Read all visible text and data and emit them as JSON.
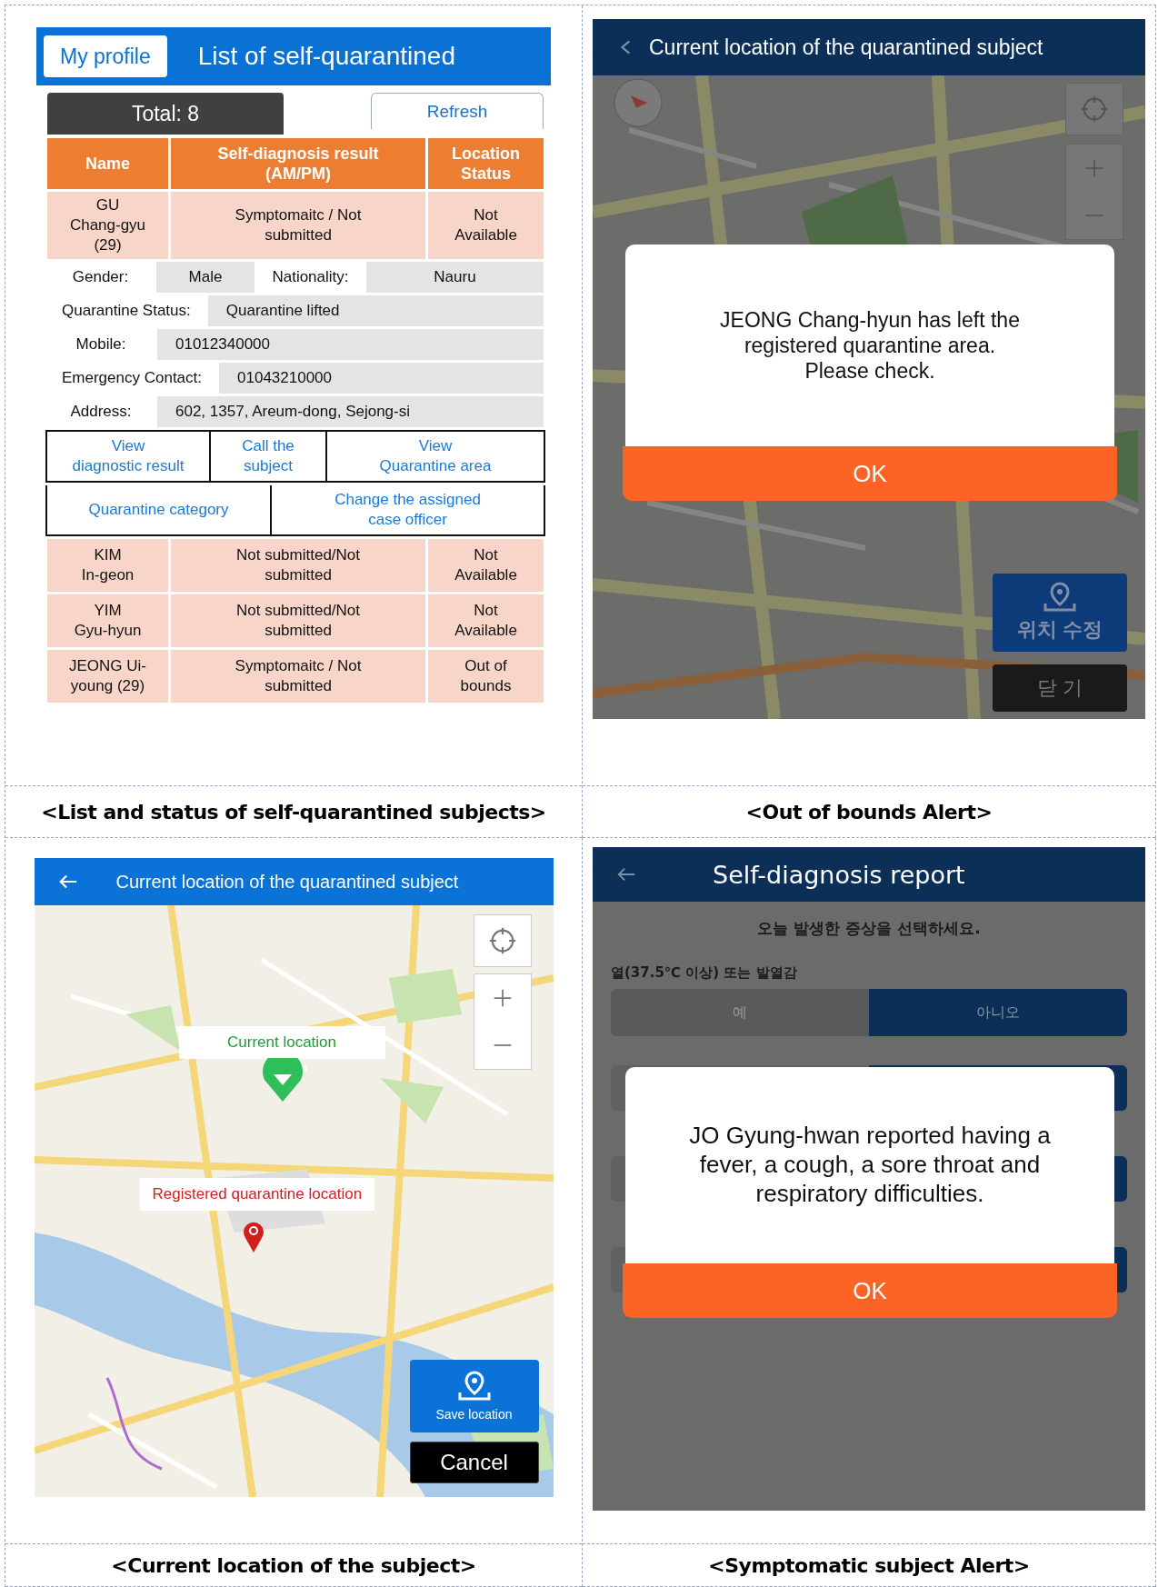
{
  "panels": [
    {
      "kind": "list",
      "caption": "<List and status of self-quarantined subjects>",
      "tab": "My profile",
      "title": "List of self-quarantined",
      "total": "Total: 8",
      "refresh": "Refresh",
      "columns": [
        "Name",
        "Self-diagnosis result\n(AM/PM)",
        "Location\nStatus"
      ],
      "rows": [
        {
          "name": "GU\nChang-gyu\n(29)",
          "result": "Symptomaitc / Not\nsubmitted",
          "location": "Not\nAvailable",
          "details": [
            [
              {
                "label": "Gender:",
                "value": "Male"
              },
              {
                "label": "Nationality:",
                "value": "Nauru"
              }
            ],
            [
              {
                "label": "Quarantine Status:",
                "value": "Quarantine lifted"
              }
            ],
            [
              {
                "label": "Mobile:",
                "value": "01012340000"
              }
            ],
            [
              {
                "label": "Emergency Contact:",
                "value": "01043210000"
              }
            ],
            [
              {
                "label": "Address:",
                "value": "602, 1357, Areum-dong, Sejong-si"
              }
            ]
          ],
          "actions": [
            [
              "View\ndiagnostic result",
              "Call the\nsubject",
              "View\nQuarantine area"
            ],
            [
              "Quarantine category",
              "Change the assigned\ncase officer"
            ]
          ]
        },
        {
          "name": "KIM\nIn-geon",
          "result": "Not submitted/Not\nsubmitted",
          "location": "Not\nAvailable"
        },
        {
          "name": "YIM\nGyu-hyun",
          "result": "Not submitted/Not\nsubmitted",
          "location": "Not\nAvailable"
        },
        {
          "name": "JEONG Ui-\nyoung (29)",
          "result": "Symptomaitc / Not\nsubmitted",
          "location": "Out of\nbounds"
        }
      ]
    },
    {
      "kind": "map_alert",
      "caption": "<Out of bounds Alert>",
      "title": "Current location of the quarantined subject",
      "alert": "JEONG Chang-hyun has left the\nregistered quarantine area.\nPlease check.",
      "ok": "OK",
      "edit_button": "위치 수정",
      "close_button": "닫 기"
    },
    {
      "kind": "map_location",
      "caption": "<Current location of the subject>",
      "title": "Current location of the quarantined subject",
      "current_label": "Current location",
      "registered_label": "Registered quarantine location",
      "save_button": "Save location",
      "cancel_button": "Cancel"
    },
    {
      "kind": "report_alert",
      "caption": "<Symptomatic subject Alert>",
      "title": "Self-diagnosis report",
      "prompt": "오늘 발생한 증상을 선택하세요.",
      "question": "열(37.5℃ 이상) 또는 발열감",
      "options": [
        {
          "label": "예",
          "selected": false
        },
        {
          "label": "아니오",
          "selected": true
        }
      ],
      "alert": "JO Gyung-hwan reported having a\nfever, a cough, a sore throat and\nrespiratory difficulties.",
      "ok": "OK"
    }
  ]
}
